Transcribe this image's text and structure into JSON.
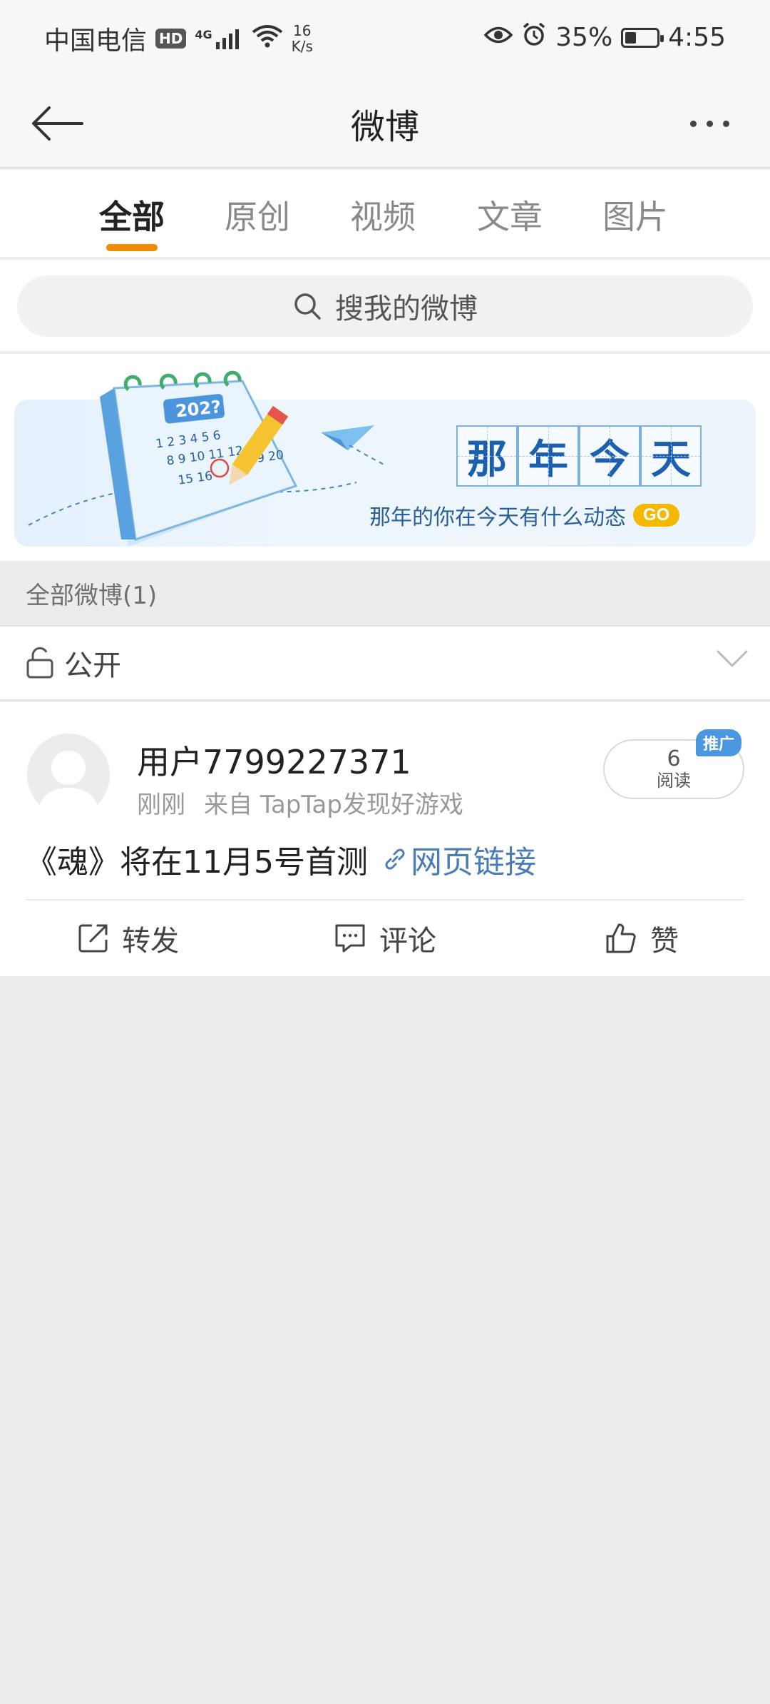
{
  "status_bar": {
    "carrier": "中国电信",
    "hd": "HD",
    "network": "4G",
    "speed_value": "16",
    "speed_unit": "K/s",
    "battery_percent": "35%",
    "battery_level": 0.35,
    "time": "4:55"
  },
  "nav": {
    "title": "微博"
  },
  "tabs": [
    {
      "label": "全部",
      "active": true
    },
    {
      "label": "原创",
      "active": false
    },
    {
      "label": "视频",
      "active": false
    },
    {
      "label": "文章",
      "active": false
    },
    {
      "label": "图片",
      "active": false
    }
  ],
  "search": {
    "placeholder": "搜我的微博"
  },
  "banner": {
    "calendar_year": "202?",
    "calendar_numbers": [
      "1 2 3 4 5 6",
      "8 9 10 11 12",
      "15 16",
      "19 20"
    ],
    "title_chars": [
      "那",
      "年",
      "今",
      "天"
    ],
    "subtitle": "那年的你在今天有什么动态",
    "go_label": "GO"
  },
  "section": {
    "header": "全部微博(1)"
  },
  "filter": {
    "label": "公开"
  },
  "post": {
    "username": "用户7799227371",
    "time": "刚刚",
    "source": "来自 TapTap发现好游戏",
    "read_count": "6",
    "read_label": "阅读",
    "promo_tag": "推广",
    "text": "《魂》将在11月5号首测",
    "link_label": "网页链接",
    "actions": {
      "repost": "转发",
      "comment": "评论",
      "like": "赞"
    }
  },
  "colors": {
    "accent_orange": "#f08b00",
    "link_blue": "#4a7db8",
    "promo_blue": "#4b98e0",
    "background": "#ededed"
  }
}
